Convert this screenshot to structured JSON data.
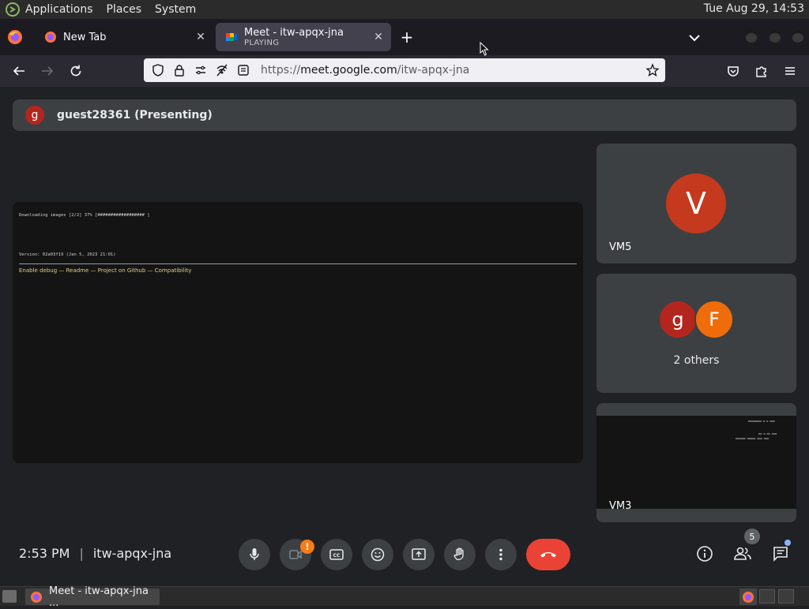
{
  "os_panel": {
    "menus": [
      "Applications",
      "Places",
      "System"
    ],
    "clock": "Tue Aug 29, 14:53"
  },
  "browser": {
    "tabs": [
      {
        "title": "New Tab",
        "subtitle": ""
      },
      {
        "title": "Meet - itw-apqx-jna",
        "subtitle": "PLAYING"
      }
    ],
    "url": "https://meet.google.com/itw-apqx-jna",
    "url_host": "meet.google.com",
    "url_prefix": "https://",
    "url_path": "/itw-apqx-jna"
  },
  "meet": {
    "presenter": {
      "initial": "g",
      "label": "guest28361 (Presenting)"
    },
    "shared_screen": {
      "line1": "Downloading images [2/2] 37% [##################                                                   ]",
      "line2": "Version: 02a03f19 (Jan 5, 2023 21:01)",
      "links": "Enable debug — Readme — Project on Github — Compatibility"
    },
    "tiles": [
      {
        "label": "VM5",
        "initial": "V",
        "color": "#c5391e"
      },
      {
        "label": "2 others",
        "avatars": [
          {
            "initial": "g",
            "color": "#b3261e"
          },
          {
            "initial": "F",
            "color": "#f06c0b"
          }
        ]
      },
      {
        "label": "VM3"
      }
    ],
    "vm3_screen": {
      "line1": "▬▬▬▬▬▬▬▬ ▬ ▬ ▬▬▬",
      "line2": "▬▬ ▬ ▬▬ ▬▬▬",
      "line3": "▬▬▬▬▬▬ ▬▬▬▬▬ ▬▬▬ ▬▬▬"
    },
    "time": "2:53 PM",
    "meeting_code": "itw-apqx-jna",
    "warn_badge": "!",
    "people_count": "5"
  },
  "taskbar": {
    "task_label": "Meet - itw-apqx-jna ..."
  },
  "colors": {
    "meet_bg": "#202124",
    "tile_bg": "#3c4043",
    "hangup": "#ea4335",
    "accent_blue": "#8ab4f8",
    "warn": "#fa7b17"
  }
}
